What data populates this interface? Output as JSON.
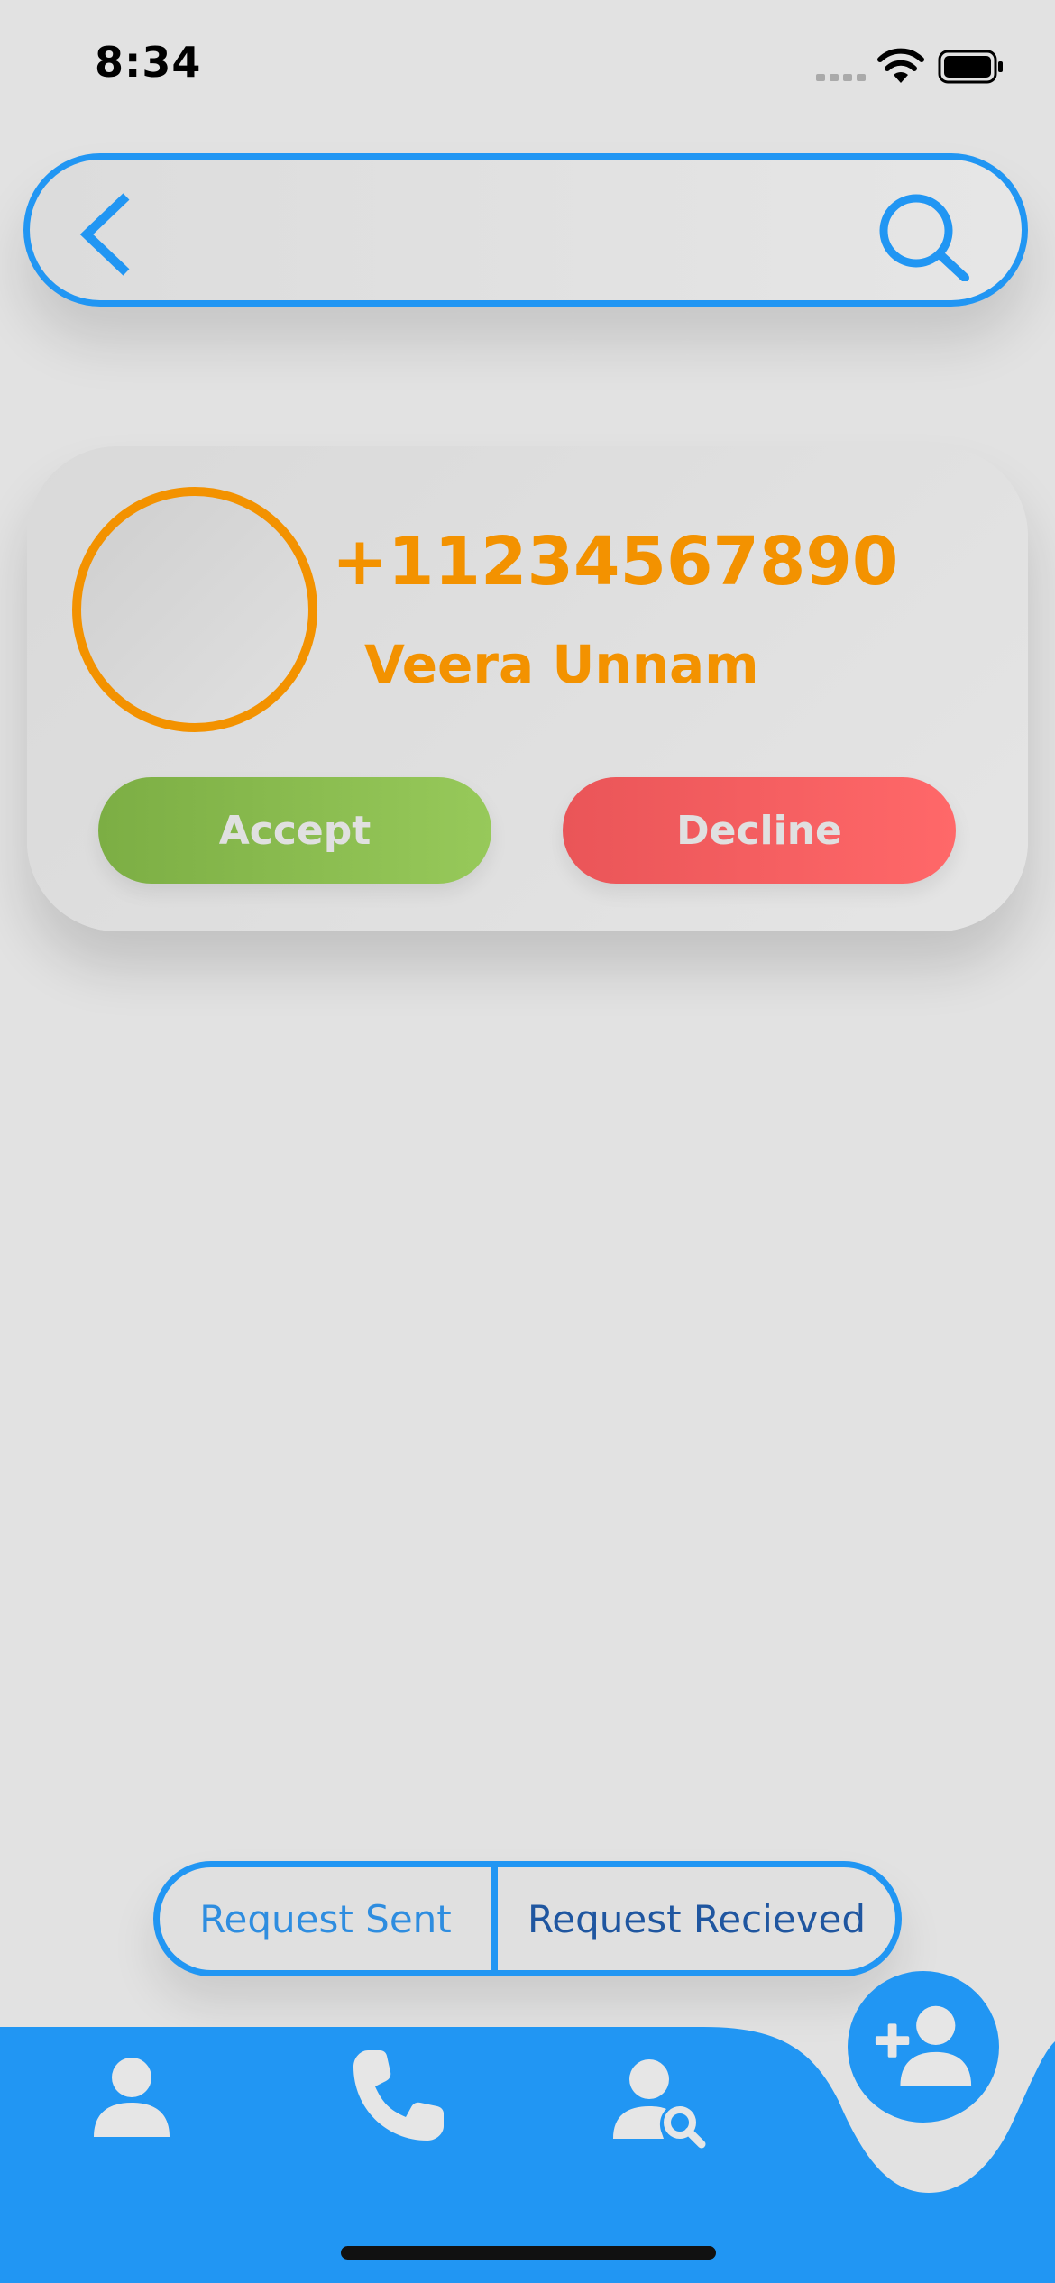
{
  "status_bar": {
    "time": "8:34",
    "icons": [
      "signal-dots-icon",
      "wifi-icon",
      "battery-icon"
    ]
  },
  "search_bar": {
    "back_icon": "chevron-left-icon",
    "search_icon": "search-icon",
    "accent_color": "#2196F3"
  },
  "request_card": {
    "phone_number": "+11234567890",
    "name": "Veera Unnam",
    "accept_label": "Accept",
    "decline_label": "Decline",
    "accent_color": "#F39200",
    "accept_color": "#8BC34A",
    "decline_color": "#FF6565"
  },
  "segmented_control": {
    "tabs": [
      {
        "label": "Request Sent",
        "selected": false
      },
      {
        "label": "Request Recieved",
        "selected": true
      }
    ]
  },
  "bottom_nav": {
    "items": [
      "person-icon",
      "phone-icon",
      "search-user-icon"
    ],
    "fab_icon": "add-user-icon",
    "color": "#2196F3"
  }
}
